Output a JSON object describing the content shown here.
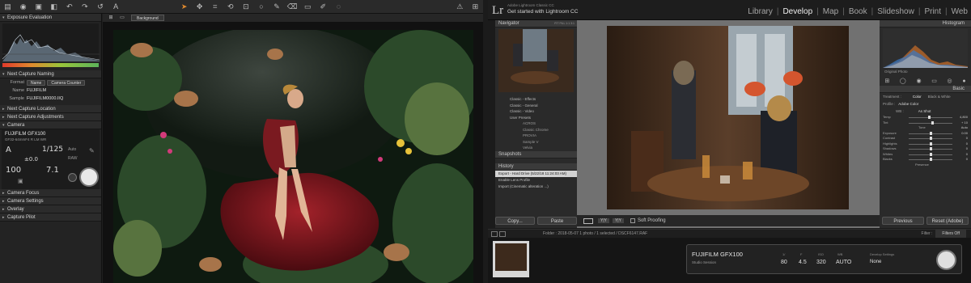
{
  "captureone": {
    "toolbar_icons": [
      "folder-icon",
      "camera-icon",
      "import-icon",
      "export-icon",
      "undo-icon",
      "redo-icon",
      "reset-icon",
      "text-icon",
      "crop-icon",
      "cursor-icon",
      "pan-icon",
      "rotate-icon",
      "keystone-icon",
      "spot-icon",
      "brush-icon",
      "eraser-icon",
      "gradient-icon",
      "picker-icon",
      "wb-icon",
      "color-icon"
    ],
    "sections": {
      "exposure": "Exposure Evaluation",
      "naming": "Next Capture Naming",
      "location": "Next Capture Location",
      "adjustments": "Next Capture Adjustments",
      "camera": "Camera",
      "focus": "Camera Focus",
      "settings": "Camera Settings",
      "overlay": "Overlay",
      "pilot": "Capture Pilot"
    },
    "naming": {
      "format_label": "Format",
      "format_pill1": "Name",
      "format_pill2": "Camera Counter",
      "name_label": "Name",
      "name_value": "FUJIFILM",
      "sample_label": "Sample",
      "sample_value": "FUJIFILM0000.IIQ"
    },
    "camera": {
      "model": "FUJIFILM GFX100",
      "lens": "GF32-64mmF4 R LM WR",
      "mode": "A",
      "shutter": "1/125",
      "ev": "±0.0",
      "iso": "100",
      "aperture": "7.1",
      "af": "Auto",
      "raw": "RAW"
    },
    "viewer": {
      "background_label": "Background"
    }
  },
  "lightroom": {
    "app_name": "Adobe Lightroom Classic CC",
    "tagline": "Get started with Lightroom CC",
    "modules": [
      "Library",
      "Develop",
      "Map",
      "Book",
      "Slideshow",
      "Print",
      "Web"
    ],
    "active_module": "Develop",
    "navigator": {
      "title": "Navigator",
      "zoom": "FIT  FILL  1:1  3:1"
    },
    "presets": [
      "Classic - Effects",
      "Classic - General",
      "Classic - Video",
      "User Presets"
    ],
    "user_presets": [
      "ACROS",
      "Classic Chrome",
      "PROVIA",
      "Sample V",
      "Velvia"
    ],
    "snapshots_title": "Snapshots",
    "history_title": "History",
    "history": [
      "Export - Hard Drive (5/22/18 11:24:03 AM)",
      "Enable Lens Profile",
      "Import (Cinematic alteration ...)"
    ],
    "copy_label": "Copy...",
    "paste_label": "Paste",
    "soft_proofing": "Soft Proofing",
    "histogram_title": "Histogram",
    "original_photo": "Original Photo",
    "basic_title": "Basic",
    "treatment_label": "Treatment :",
    "treatment_color": "Color",
    "treatment_bw": "Black & White",
    "profile_label": "Profile :",
    "profile_value": "Adobe Color",
    "wb_label": "WB :",
    "wb_value": "As Shot",
    "sliders": [
      {
        "name": "Temp",
        "value": "4,800"
      },
      {
        "name": "Tint",
        "value": "+ 10"
      },
      {
        "name": "Tone",
        "value": "Auto"
      },
      {
        "name": "Exposure",
        "value": "0.00"
      },
      {
        "name": "Contrast",
        "value": "0"
      },
      {
        "name": "Highlights",
        "value": "0"
      },
      {
        "name": "Shadows",
        "value": "0"
      },
      {
        "name": "Whites",
        "value": "0"
      },
      {
        "name": "Blacks",
        "value": "0"
      },
      {
        "name": "Presence",
        "value": ""
      }
    ],
    "previous_label": "Previous",
    "reset_label": "Reset (Adobe)",
    "filmstrip": {
      "info": "Folder : 2018-05-07     1 photo / 1 selected / DSCF6147.RAF",
      "filter_label": "Filter :",
      "filter_value": "Filters Off"
    },
    "tether": {
      "camera": "FUJIFILM GFX100",
      "session": "Studio Session",
      "labels": [
        "1/",
        "F",
        "ISO",
        "WB"
      ],
      "values": [
        "80",
        "4.5",
        "320",
        "AUTO"
      ],
      "develop_label": "Develop Settings",
      "develop_value": "None"
    }
  }
}
